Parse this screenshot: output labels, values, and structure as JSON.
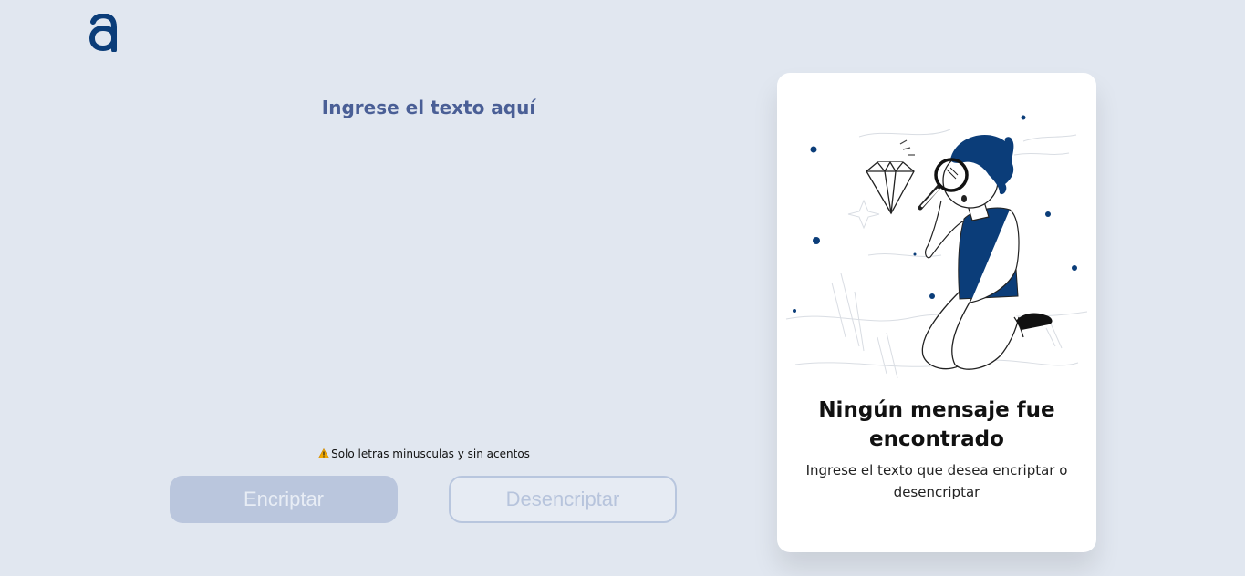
{
  "logo": {
    "icon": "alura-logo-icon",
    "color": "#0b3d79"
  },
  "input": {
    "placeholder": "Ingrese el texto aquí",
    "value": ""
  },
  "warning": {
    "icon": "warning-icon",
    "text": "Solo letras minusculas y sin acentos"
  },
  "buttons": {
    "encrypt_label": "Encriptar",
    "decrypt_label": "Desencriptar"
  },
  "result_panel": {
    "illustration": "person-with-magnifying-glass-illustration",
    "title": "Ningún mensaje fue encontrado",
    "subtitle": "Ingrese el texto que desea encriptar o desencriptar"
  },
  "colors": {
    "background": "#e1e7f0",
    "accent": "#0b3d79",
    "placeholder": "#4a5f96",
    "encrypt_button": "#bac6dd",
    "panel": "#ffffff"
  }
}
